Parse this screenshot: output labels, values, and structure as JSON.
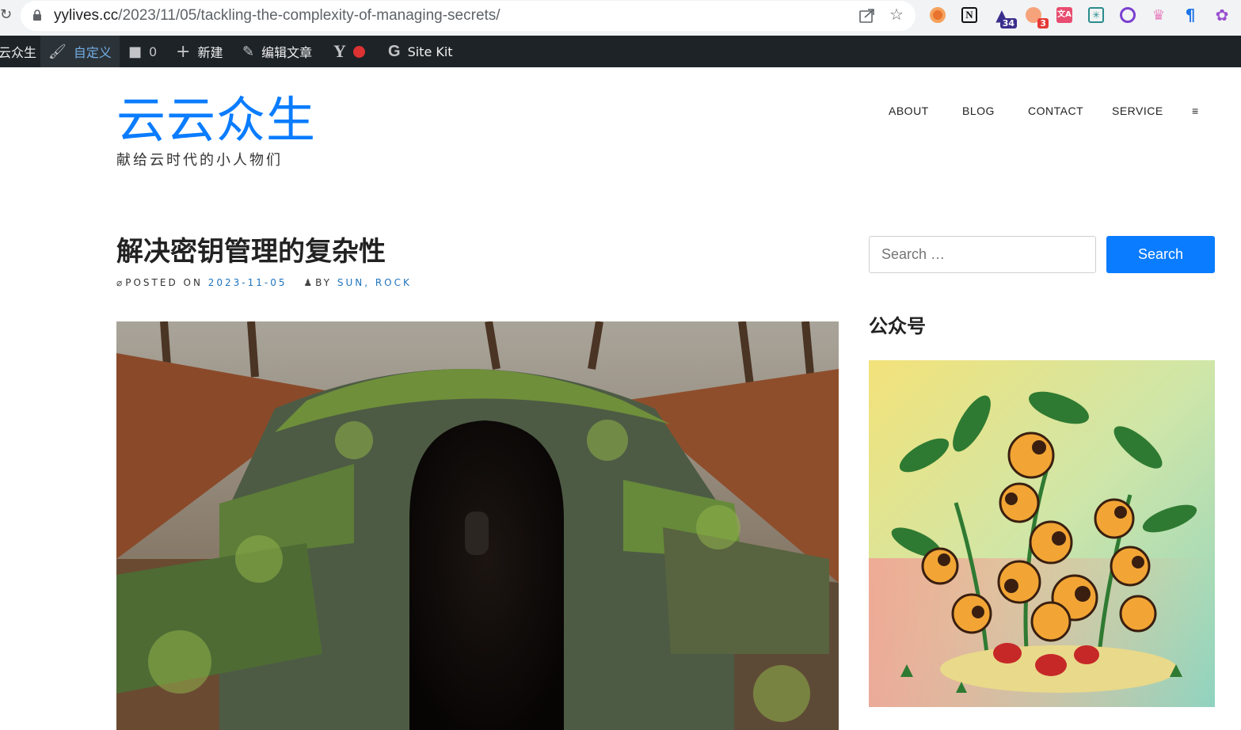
{
  "browser": {
    "url_host": "yylives.cc",
    "url_path": "/2023/11/05/tackling-the-complexity-of-managing-secrets/",
    "extensions": [
      {
        "icon": "record-extension-icon",
        "badge": ""
      },
      {
        "icon": "notion-icon",
        "badge": ""
      },
      {
        "icon": "graduation-cap-icon",
        "badge": "34"
      },
      {
        "icon": "bubbles-extension-icon",
        "badge": "3"
      },
      {
        "icon": "translate-icon",
        "badge": ""
      },
      {
        "icon": "grid-extension-icon",
        "badge": ""
      },
      {
        "icon": "purple-circle-icon",
        "badge": ""
      },
      {
        "icon": "crown-icon",
        "badge": ""
      },
      {
        "icon": "blue-flag-icon",
        "badge": ""
      },
      {
        "icon": "openai-icon",
        "badge": ""
      }
    ]
  },
  "adminbar": {
    "site_name": "云众生",
    "customize": "自定义",
    "comments": "0",
    "new": "新建",
    "edit": "编辑文章",
    "sitekit": "Site Kit"
  },
  "site": {
    "title": "云云众生",
    "tagline": "献给云时代的小人物们"
  },
  "nav": {
    "items": [
      "ABOUT",
      "BLOG",
      "CONTACT",
      "SERVICE"
    ],
    "more_glyph": "≡"
  },
  "post": {
    "title": "解决密钥管理的复杂性",
    "posted_on_label": "POSTED ON",
    "date": "2023-11-05",
    "by_label": "BY",
    "author": "SUN, ROCK"
  },
  "sidebar": {
    "search_placeholder": "Search …",
    "search_button": "Search",
    "widget_title": "公众号"
  },
  "colors": {
    "accent": "#0a7cff",
    "adminbar_bg": "#1d2327",
    "link": "#1e73be"
  }
}
